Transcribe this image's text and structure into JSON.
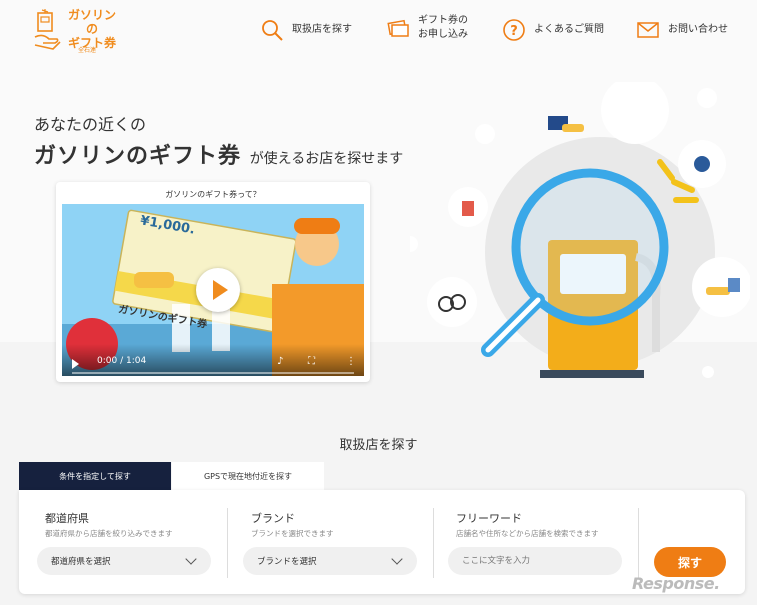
{
  "logo": {
    "line1": "ガソリン",
    "line2": "の",
    "line3": "ギフト券",
    "sub": "全石連"
  },
  "nav": [
    {
      "icon": "search-icon",
      "label": "取扱店を探す"
    },
    {
      "icon": "ticket-icon",
      "label": "ギフト券の\nお申し込み"
    },
    {
      "icon": "question-icon",
      "label": "よくあるご質問"
    },
    {
      "icon": "mail-icon",
      "label": "お問い合わせ"
    }
  ],
  "hero": {
    "line1": "あなたの近くの",
    "line2_strong": "ガソリンのギフト券",
    "line2_rest": "が使えるお店を探せます"
  },
  "video": {
    "title": "ガソリンのギフト券って？",
    "time": "0:00 / 1:04",
    "ticket_amount": "¥1,000.",
    "ticket_label": "ガソリンのギフト券"
  },
  "search": {
    "section_title": "取扱店を探す",
    "tabs": [
      "条件を指定して探す",
      "GPSで現在地付近を探す"
    ],
    "prefecture": {
      "label": "都道府県",
      "hint": "都道府県から店舗を絞り込みできます",
      "select": "都道府県を選択"
    },
    "brand": {
      "label": "ブランド",
      "hint": "ブランドを選択できます",
      "select": "ブランドを選択"
    },
    "freeword": {
      "label": "フリーワード",
      "hint": "店舗名や住所などから店舗を検索できます",
      "placeholder": "ここに文字を入力"
    },
    "button": "探す"
  },
  "watermark": "Response.",
  "colors": {
    "accent": "#ef7d14",
    "navy": "#16213e",
    "magnifier": "#3aa8e8"
  }
}
